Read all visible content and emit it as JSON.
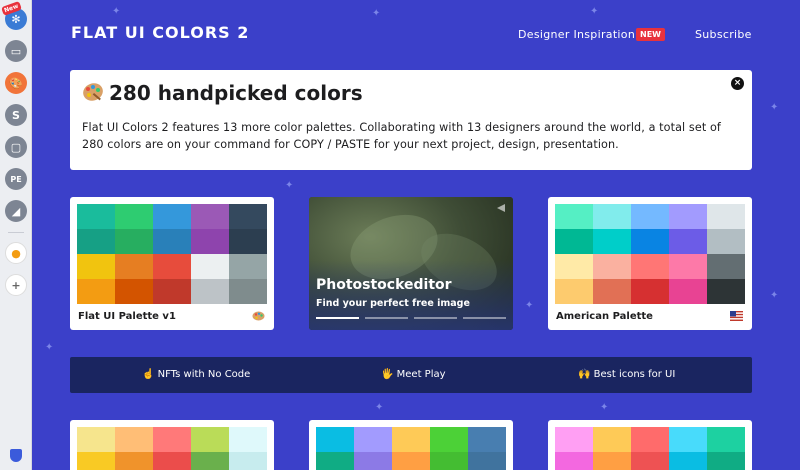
{
  "rail": {
    "new_badge": "New",
    "items": [
      "snowflake-icon",
      "browser-icon",
      "palette-icon",
      "s-icon",
      "card-icon",
      "pe-icon",
      "chart-icon",
      "fruit-icon",
      "add-icon",
      "shield-icon"
    ]
  },
  "header": {
    "brand": "FLAT UI COLORS 2",
    "nav_inspiration": "Designer Inspiration",
    "nav_new": "NEW",
    "nav_subscribe": "Subscribe"
  },
  "intro": {
    "title": "280 handpicked colors",
    "text": "Flat UI Colors 2 features 13 more color palettes. Collaborating with 13 designers around the world, a total set of 280 colors are on your command for COPY / PASTE for your next project, design, presentation.",
    "close": "×"
  },
  "palettes": [
    {
      "title": "Flat UI Palette v1",
      "icon": "palette-emoji",
      "colors": [
        "#1abc9c",
        "#2ecc71",
        "#3498db",
        "#9b59b6",
        "#34495e",
        "#16a085",
        "#27ae60",
        "#2980b9",
        "#8e44ad",
        "#2c3e50",
        "#f1c40f",
        "#e67e22",
        "#e74c3c",
        "#ecf0f1",
        "#95a5a6",
        "#f39c12",
        "#d35400",
        "#c0392b",
        "#bdc3c7",
        "#7f8c8d"
      ]
    },
    {
      "title": "American Palette",
      "icon": "us-flag",
      "colors": [
        "#55efc4",
        "#81ecec",
        "#74b9ff",
        "#a29bfe",
        "#dfe6e9",
        "#00b894",
        "#00cec9",
        "#0984e3",
        "#6c5ce7",
        "#b2bec3",
        "#ffeaa7",
        "#fab1a0",
        "#ff7675",
        "#fd79a8",
        "#636e72",
        "#fdcb6e",
        "#e17055",
        "#d63031",
        "#e84393",
        "#2d3436"
      ]
    }
  ],
  "ad": {
    "title": "Photostockeditor",
    "subtitle": "Find your perfect free image",
    "active_slide": 1,
    "slide_count": 4
  },
  "linkbar": {
    "item1": "☝️ NFTs with No Code",
    "item2": "🖐 Meet Play",
    "item3": "🙌 Best icons for UI"
  },
  "bottom_palettes": [
    {
      "colors": [
        "#f6e58d",
        "#ffbe76",
        "#ff7979",
        "#badc58",
        "#dff9fb",
        "#f9ca24",
        "#f0932b",
        "#eb4d4b",
        "#6ab04c",
        "#c7ecee"
      ]
    },
    {
      "colors": [
        "#0abde3",
        "#a29bfe",
        "#feca57",
        "#4cd137",
        "#487eb0",
        "#10ac84",
        "#8c7ae6",
        "#ff9f43",
        "#44bd32",
        "#40739e"
      ]
    },
    {
      "colors": [
        "#ff9ff3",
        "#feca57",
        "#ff6b6b",
        "#48dbfb",
        "#1dd1a1",
        "#f368e0",
        "#ff9f43",
        "#ee5253",
        "#0abde3",
        "#10ac84"
      ]
    }
  ],
  "colors": {
    "background": "#3b40c9",
    "new_badge": "#e8323c",
    "linkbar": "#1a2560"
  }
}
